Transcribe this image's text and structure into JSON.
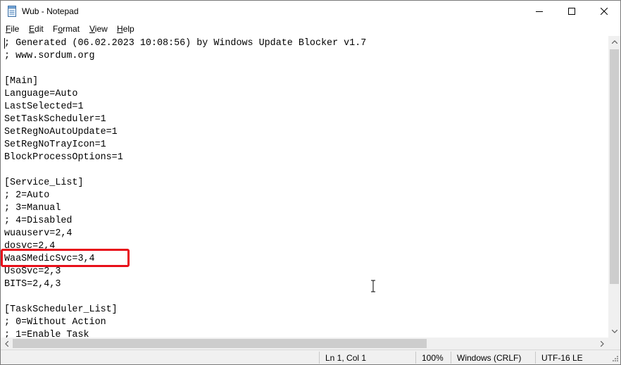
{
  "window": {
    "title": "Wub - Notepad"
  },
  "menu": [
    {
      "key": "F",
      "rest": "ile"
    },
    {
      "key": "E",
      "rest": "dit"
    },
    {
      "key": "",
      "pre": "F",
      "rest_ul": "o",
      "post": "rmat"
    },
    {
      "key": "V",
      "rest": "iew"
    },
    {
      "key": "H",
      "rest": "elp"
    }
  ],
  "menu_labels": {
    "file_key": "F",
    "file_rest": "ile",
    "edit_key": "E",
    "edit_rest": "dit",
    "format_pre": "F",
    "format_key": "o",
    "format_rest": "rmat",
    "view_key": "V",
    "view_rest": "iew",
    "help_key": "H",
    "help_rest": "elp"
  },
  "editor": {
    "lines": [
      "; Generated (06.02.2023 10:08:56) by Windows Update Blocker v1.7",
      "; www.sordum.org",
      "",
      "[Main]",
      "Language=Auto",
      "LastSelected=1",
      "SetTaskScheduler=1",
      "SetRegNoAutoUpdate=1",
      "SetRegNoTrayIcon=1",
      "BlockProcessOptions=1",
      "",
      "[Service_List]",
      "; 2=Auto",
      "; 3=Manual",
      "; 4=Disabled",
      "wuauserv=2,4",
      "dosvc=2,4",
      "WaaSMedicSvc=3,4",
      "UsoSvc=2,3",
      "BITS=2,4,3",
      "",
      "[TaskScheduler_List]",
      "; 0=Without Action",
      "; 1=Enable Task"
    ],
    "highlighted_line": "WaaSMedicSvc=3,4"
  },
  "status": {
    "position": "Ln 1, Col 1",
    "zoom": "100%",
    "line_endings": "Windows (CRLF)",
    "encoding": "UTF-16 LE"
  },
  "colors": {
    "highlight_border": "#e8101a",
    "chrome": "#f0f0f0"
  }
}
